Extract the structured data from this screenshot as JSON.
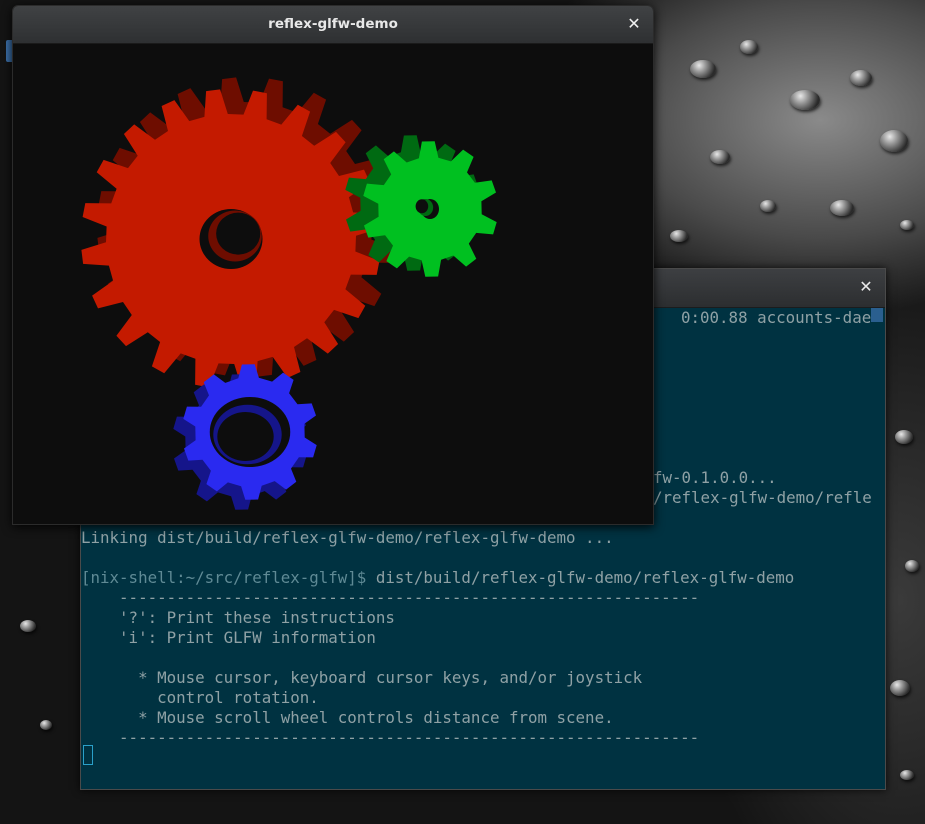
{
  "gl_window": {
    "title": "reflex-glfw-demo",
    "close_icon": "close-icon",
    "gears": [
      {
        "name": "red-gear",
        "color": "#c41a00",
        "side": "#6e0d00",
        "teeth": 20
      },
      {
        "name": "green-gear",
        "color": "#00c020",
        "side": "#006a12",
        "teeth": 10
      },
      {
        "name": "blue-gear",
        "color": "#2a2af0",
        "side": "#15158a",
        "teeth": 10
      }
    ]
  },
  "terminal": {
    "close_icon": "close-icon",
    "colors": {
      "background": "#003241",
      "text": "#8fa1a5",
      "cursor": "#2aa0c9"
    },
    "lines": {
      "htop": "0:00.88 accounts-dae",
      "build1": "fw-0.1.0.0...",
      "build2": "/reflex-glfw-demo/refle",
      "linking": "Linking dist/build/reflex-glfw-demo/reflex-glfw-demo ...",
      "prompt": "[nix-shell:~/src/reflex-glfw]$",
      "command": " dist/build/reflex-glfw-demo/reflex-glfw-demo",
      "rule1": "    -------------------------------------------------------------",
      "help1": "    '?': Print these instructions",
      "help2": "    'i': Print GLFW information",
      "help3": "      * Mouse cursor, keyboard cursor keys, and/or joystick",
      "help4": "        control rotation.",
      "help5": "      * Mouse scroll wheel controls distance from scene.",
      "rule2": "    -------------------------------------------------------------"
    }
  }
}
